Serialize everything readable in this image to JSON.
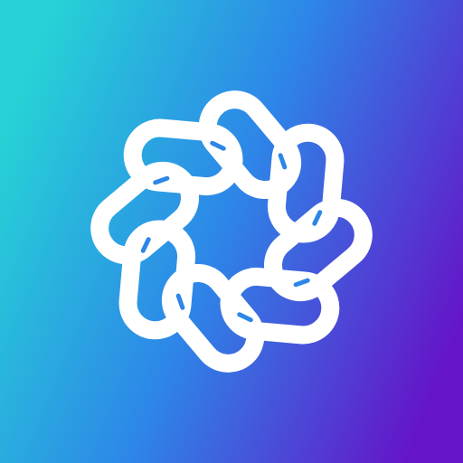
{
  "app_icon": {
    "icon": "interlaced-knot-icon",
    "colors": {
      "gradient_start": "#26D2D6",
      "gradient_mid": "#2D86E8",
      "gradient_end": "#6514C8",
      "logo": "#FFFFFF"
    },
    "loop_count": 8
  }
}
